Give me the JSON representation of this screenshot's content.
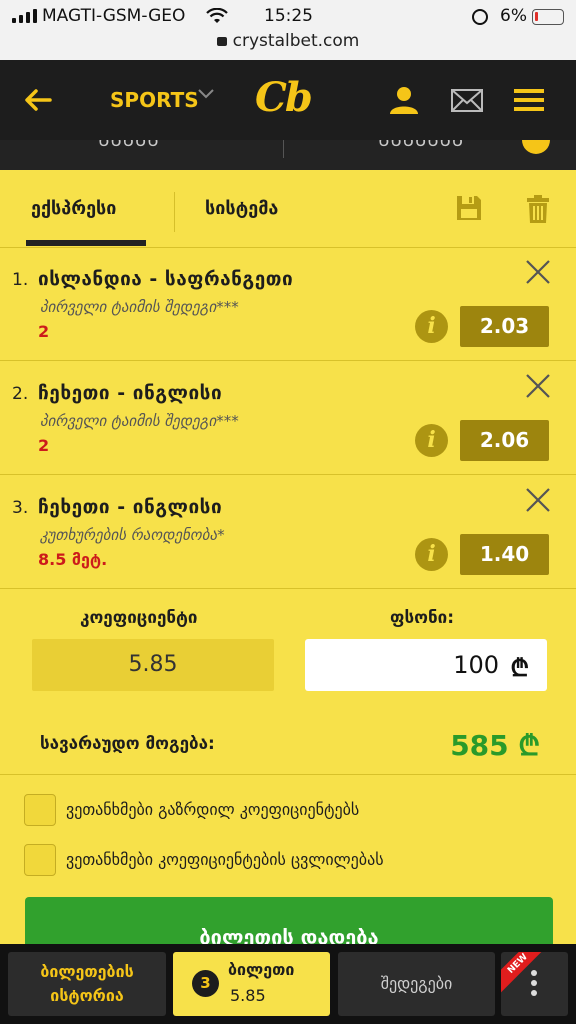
{
  "status_bar": {
    "carrier": "MAGTI-GSM-GEO",
    "time": "15:25",
    "battery": "6%",
    "url": "crystalbet.com"
  },
  "header": {
    "sports_label": "SPORTS",
    "logo": "Cb"
  },
  "tabs": {
    "express": "ექსპრესი",
    "system": "სისტემა"
  },
  "bets": [
    {
      "index": "1.",
      "match": "ისლანდია - საფრანგეთი",
      "market": "პირველი ტაიმის შედეგი***",
      "pick": "2",
      "odd": "2.03"
    },
    {
      "index": "2.",
      "match": "ჩეხეთი - ინგლისი",
      "market": "პირველი ტაიმის შედეგი***",
      "pick": "2",
      "odd": "2.06"
    },
    {
      "index": "3.",
      "match": "ჩეხეთი - ინგლისი",
      "market": "კუთხურების რაოდენობა*",
      "pick": "8.5 მეტ.",
      "odd": "1.40"
    }
  ],
  "summary": {
    "coef_label": "კოეფიციენტი",
    "coef_value": "5.85",
    "stake_label": "ფსონი:",
    "stake_value": "100",
    "currency": "₾",
    "win_label": "სავარაუდო მოგება:",
    "win_value": "585 ₾"
  },
  "options": {
    "accept_increased": "ვეთანხმები გაზრდილ კოეფიციენტებს",
    "accept_changes": "ვეთანხმები კოეფიციენტების ცვლილებას"
  },
  "place_bet": "ბილეთის დადება",
  "bottom_bar": {
    "history_line1": "ბილეთების",
    "history_line2": "ისტორია",
    "slip_count": "3",
    "slip_label": "ბილეთი",
    "slip_odd": "5.85",
    "results": "შედეგები",
    "new_badge": "NEW"
  },
  "colors": {
    "accent": "#f5c518",
    "panel": "#f7e14a",
    "header": "#1d1d1d",
    "win": "#2a9a2a",
    "pick": "#cc1b1b"
  }
}
